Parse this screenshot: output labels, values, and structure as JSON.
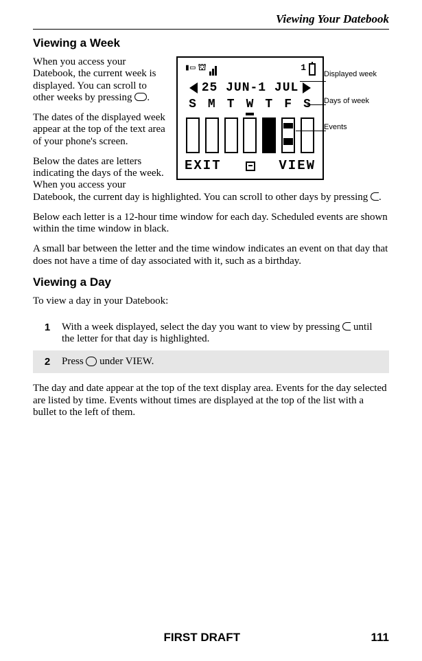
{
  "header": {
    "running_title": "Viewing Your Datebook"
  },
  "section1": {
    "heading": "Viewing a Week",
    "p1_a": "When you access your Datebook, the current week is displayed. You can scroll to other weeks by pressing ",
    "p1_b": ".",
    "p2": "The dates of the displayed week appear at the top of the text area of your phone's screen.",
    "p3_a": "Below the dates are letters indicating the days of the week. When you access your Datebook, the current day is highlighted. You can scroll to other days by pressing ",
    "p3_b": ".",
    "p4": "Below each letter is a 12-hour time window for each day. Scheduled events are shown within the time window in black.",
    "p5": "A small bar between the letter and the time window indicates an event on that day that does not have a time of day associated with it, such as a birthday."
  },
  "figure": {
    "date_range": "25 JUN-1 JUL",
    "days": [
      "S",
      "M",
      "T",
      "W",
      "T",
      "F",
      "S"
    ],
    "exit": "EXIT",
    "view": "VIEW",
    "callout1": "Displayed week",
    "callout2": "Days of week",
    "callout3": "Events",
    "icon_digit": "1"
  },
  "section2": {
    "heading": "Viewing a Day",
    "intro": "To view a day in your Datebook:",
    "steps": [
      {
        "num": "1",
        "text_a": "With a week displayed, select the day you want to view by pressing ",
        "text_b": " until the letter for that day is highlighted."
      },
      {
        "num": "2",
        "text_a": "Press ",
        "text_b": " under VIEW."
      }
    ],
    "after": "The day and date appear at the top of the text display area. Events for the day selected are listed by time. Events without times are displayed at the top of the list with a bullet to the left of them."
  },
  "footer": {
    "draft": "FIRST DRAFT",
    "page": "111"
  }
}
